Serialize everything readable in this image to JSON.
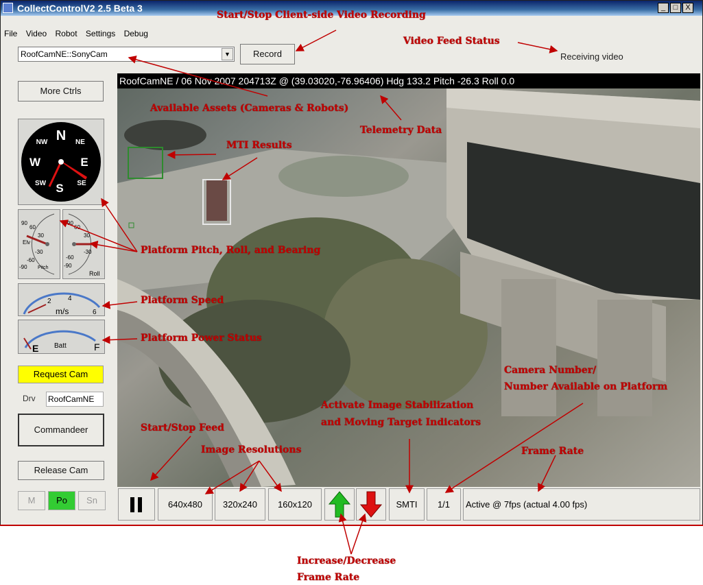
{
  "window": {
    "title": "CollectControlV2 2.5 Beta 3",
    "controls": [
      "_",
      "□",
      "X"
    ]
  },
  "menu": [
    "File",
    "Video",
    "Robot",
    "Settings",
    "Debug"
  ],
  "asset_select": {
    "value": "RoofCamNE::SonyCam"
  },
  "record_label": "Record",
  "video_status": "Receiving video",
  "telemetry": "RoofCamNE / 06 Nov 2007 204713Z @ (39.03020,-76.96406) Hdg 133.2 Pitch -26.3 Roll 0.0",
  "left_panel": {
    "more_ctrls": "More Ctrls",
    "compass": {
      "n": "N",
      "e": "E",
      "s": "S",
      "w": "W",
      "ne": "NE",
      "se": "SE",
      "sw": "SW",
      "nw": "NW"
    },
    "pitch_gauge": {
      "labels": [
        "90",
        "60",
        "30",
        "Elv",
        "-30",
        "-60",
        "-90",
        "Pitch"
      ]
    },
    "roll_gauge": {
      "labels": [
        "90",
        "60",
        "30",
        "-30",
        "-60",
        "-90",
        "Roll"
      ]
    },
    "speed_gauge": {
      "labels": [
        "2",
        "4",
        "6",
        "m/s"
      ]
    },
    "power_gauge": {
      "labels": [
        "E",
        "Batt",
        "F"
      ]
    },
    "request_cam": "Request Cam",
    "drv_label": "Drv",
    "drv_value": "RoofCamNE",
    "commandeer": "Commandeer",
    "release_cam": "Release Cam",
    "modes": [
      {
        "label": "M",
        "active": false
      },
      {
        "label": "Po",
        "active": true
      },
      {
        "label": "Sn",
        "active": false
      }
    ]
  },
  "toolbar": {
    "resolutions": [
      "640x480",
      "320x240",
      "160x120"
    ],
    "smti": "SMTI",
    "camera_index": "1/1",
    "frame_rate": "Active @ 7fps (actual 4.00 fps)"
  },
  "annotations": {
    "recording": "Start/Stop Client-side Video Recording",
    "feed_status": "Video Feed Status",
    "assets": "Available Assets (Cameras & Robots)",
    "telemetry": "Telemetry Data",
    "mti": "MTI Results",
    "pitch_roll": "Platform Pitch, Roll, and Bearing",
    "speed": "Platform Speed",
    "power": "Platform Power Status",
    "camera_number_1": "Camera Number/",
    "camera_number_2": "Number Available on Platform",
    "stabilization_1": "Activate Image Stabilization",
    "stabilization_2": "and Moving Target Indicators",
    "start_stop": "Start/Stop Feed",
    "resolutions": "Image Resolutions",
    "frame_rate": "Frame Rate",
    "inc_dec_1": "Increase/Decrease",
    "inc_dec_2": "Frame Rate"
  },
  "colors": {
    "annotation": "#c00000",
    "request_cam": "#ffff00",
    "mode_active": "#33cc33",
    "arrow_up": "#22bb22",
    "arrow_down": "#dd1111"
  }
}
